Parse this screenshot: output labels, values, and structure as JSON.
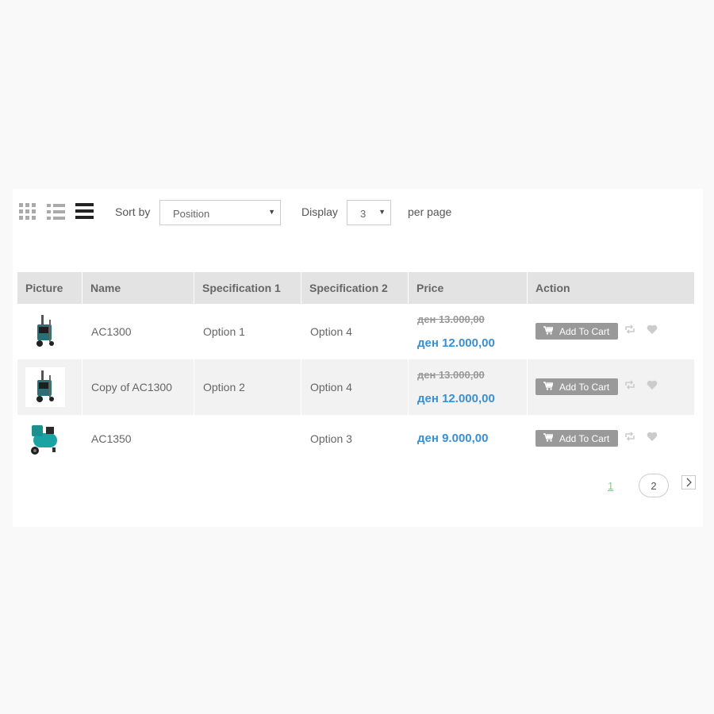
{
  "toolbar": {
    "sort_label": "Sort by",
    "sort_value": "Position",
    "display_label": "Display",
    "display_value": "3",
    "per_page_label": "per page"
  },
  "table": {
    "headers": [
      "Picture",
      "Name",
      "Specification 1",
      "Specification 2",
      "Price",
      "Action"
    ],
    "rows": [
      {
        "name": "AC1300",
        "spec1": "Option 1",
        "spec2": "Option 4",
        "old_price": "ден 13.000,00",
        "price": "ден 12.000,00",
        "cart_label": "Add To Cart"
      },
      {
        "name": "Copy of AC1300",
        "spec1": "Option 2",
        "spec2": "Option 4",
        "old_price": "ден 13.000,00",
        "price": "ден 12.000,00",
        "cart_label": "Add To Cart"
      },
      {
        "name": "AC1350",
        "spec1": "",
        "spec2": "Option 3",
        "old_price": "",
        "price": "ден 9.000,00",
        "cart_label": "Add To Cart"
      }
    ]
  },
  "pagination": {
    "current": "1",
    "next_page": "2"
  },
  "colors": {
    "price": "#3a8fd1",
    "header_bg": "#e3e3e3",
    "button_bg": "#999999"
  },
  "icons": [
    "grid-view-icon",
    "list-view-icon",
    "table-view-icon",
    "cart-icon",
    "compare-icon",
    "heart-icon",
    "chevron-right-icon"
  ]
}
